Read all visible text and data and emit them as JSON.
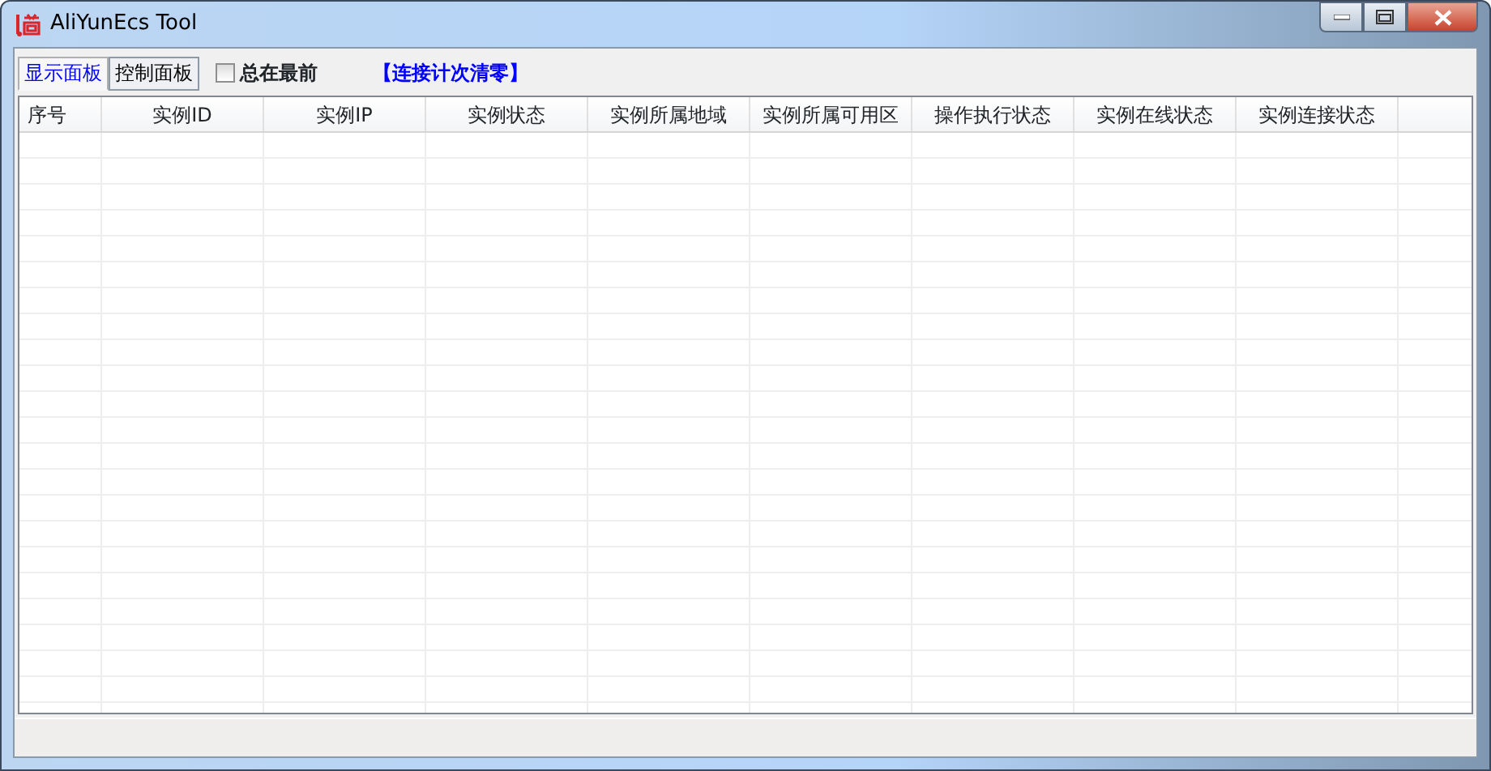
{
  "window": {
    "title": "AliYunEcs Tool"
  },
  "tabs": [
    {
      "label": "显示面板",
      "selected": true
    },
    {
      "label": "控制面板",
      "selected": false
    }
  ],
  "always_on_top": {
    "label": "总在最前",
    "checked": false
  },
  "reset_link": {
    "label": "【连接计次清零】"
  },
  "table": {
    "columns": [
      "序号",
      "实例ID",
      "实例IP",
      "实例状态",
      "实例所属地域",
      "实例所属可用区",
      "操作执行状态",
      "实例在线状态",
      "实例连接状态"
    ]
  }
}
